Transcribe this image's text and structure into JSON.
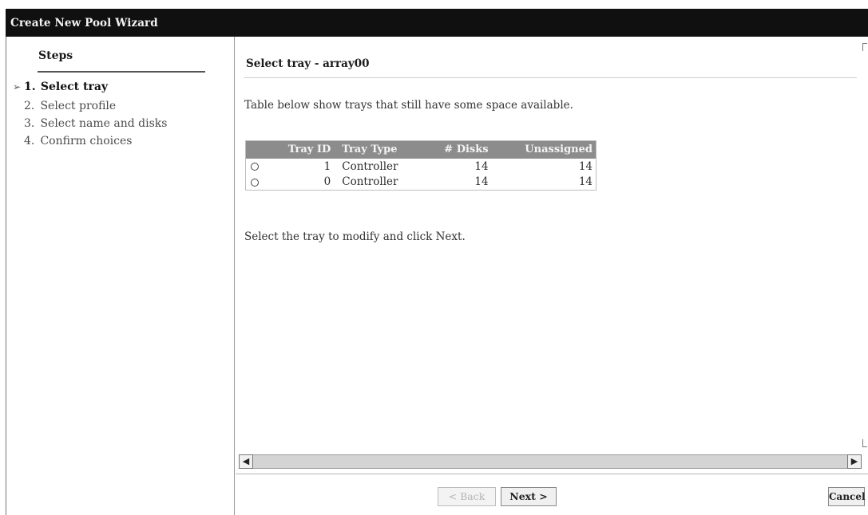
{
  "window": {
    "title": "Create New Pool Wizard"
  },
  "steps": {
    "heading": "Steps",
    "items": [
      {
        "number": "1.",
        "label": "Select tray"
      },
      {
        "number": "2.",
        "label": "Select profile"
      },
      {
        "number": "3.",
        "label": "Select name and disks"
      },
      {
        "number": "4.",
        "label": "Confirm choices"
      }
    ],
    "current_icon": "current-step-arrow-icon"
  },
  "content": {
    "title": "Select tray - array00",
    "intro": "Table below show trays that still have some space available.",
    "table": {
      "columns": [
        "",
        "Tray ID",
        "Tray Type",
        "# Disks",
        "Unassigned"
      ],
      "rows": [
        {
          "selected": false,
          "tray_id": "1",
          "tray_type": "Controller",
          "disks": "14",
          "unassigned": "14"
        },
        {
          "selected": false,
          "tray_id": "0",
          "tray_type": "Controller",
          "disks": "14",
          "unassigned": "14"
        }
      ]
    },
    "instruction": "Select the tray to modify and click Next."
  },
  "buttons": {
    "back": "< Back",
    "next": "Next >",
    "cancel": "Cancel"
  }
}
